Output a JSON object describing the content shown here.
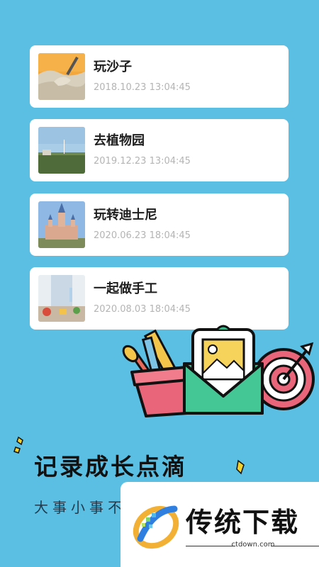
{
  "entries": [
    {
      "title": "玩沙子",
      "time": "2018.10.23 13:04:45",
      "thumb": "sand-photo"
    },
    {
      "title": "去植物园",
      "time": "2019.12.23 13:04:45",
      "thumb": "garden-photo"
    },
    {
      "title": "玩转迪士尼",
      "time": "2020.06.23 18:04:45",
      "thumb": "castle-photo"
    },
    {
      "title": "一起做手工",
      "time": "2020.08.03 18:04:45",
      "thumb": "craft-photo"
    }
  ],
  "promo": {
    "slogan": "记录成长点滴",
    "sub_slogan": "大事小事不"
  },
  "watermark": {
    "title": "传统下载",
    "url": "ctdown.com"
  },
  "colors": {
    "background": "#5bbfe3",
    "card": "#ffffff",
    "title_text": "#1e1e1e",
    "time_text": "#b4b4b4"
  }
}
